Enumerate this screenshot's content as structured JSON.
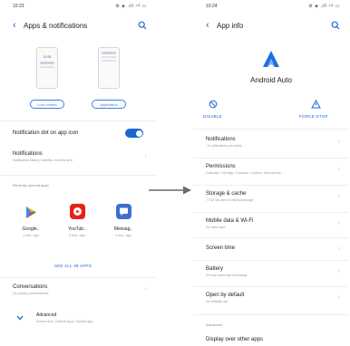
{
  "left": {
    "status": {
      "time": "10:23",
      "icons": "⚙ ◈ .ıll ⁴ᴳ ▭"
    },
    "title": "Apps & notifications",
    "mock_time": "10:28",
    "lock_screen_label": "Lock screen",
    "application_label": "Application",
    "notification_dot": "Notification dot on app icon",
    "notifications": {
      "title": "Notifications",
      "sub": "Notification history, bubbles, recently sent"
    },
    "recently_opened": "Recently opened apps",
    "apps": [
      {
        "name": "Google..",
        "time": "1 min. ago",
        "icon": "play-store-icon",
        "color": "#34a853"
      },
      {
        "name": "YouTub..",
        "time": "3 min. ago",
        "icon": "youtube-icon",
        "color": "#e62117"
      },
      {
        "name": "Messag..",
        "time": "1 min. ago",
        "icon": "messages-icon",
        "color": "#3c6fd1"
      }
    ],
    "see_all": "SEE ALL 39 APPS",
    "conversations": {
      "title": "Conversations",
      "sub": "No priority conversations"
    },
    "advanced": {
      "title": "Advanced",
      "sub": "Screen time, Default apps, Special app.."
    }
  },
  "right": {
    "status": {
      "time": "10:24",
      "icons": "⚙ ◈ .ıll ⁴ᴳ ▭"
    },
    "title": "App info",
    "app_name": "Android Auto",
    "disable": "DISABLE",
    "force_stop": "FORCE STOP",
    "items": [
      {
        "title": "Notifications",
        "sub": "~0 notifications per week"
      },
      {
        "title": "Permissions",
        "sub": "Calendar, Call logs, Contacts, Location, Microphone, ..."
      },
      {
        "title": "Storage & cache",
        "sub": "77.82 kB used in internal storage"
      },
      {
        "title": "Mobile data & Wi-Fi",
        "sub": "No data used"
      },
      {
        "title": "Screen time",
        "sub": ""
      },
      {
        "title": "Battery",
        "sub": "0% use since last full charge"
      },
      {
        "title": "Open by default",
        "sub": "No defaults set"
      }
    ],
    "advanced": "Advanced",
    "display_over": "Display over other apps"
  },
  "colors": {
    "accent": "#1a66d6",
    "muted": "#9a9a9a"
  }
}
